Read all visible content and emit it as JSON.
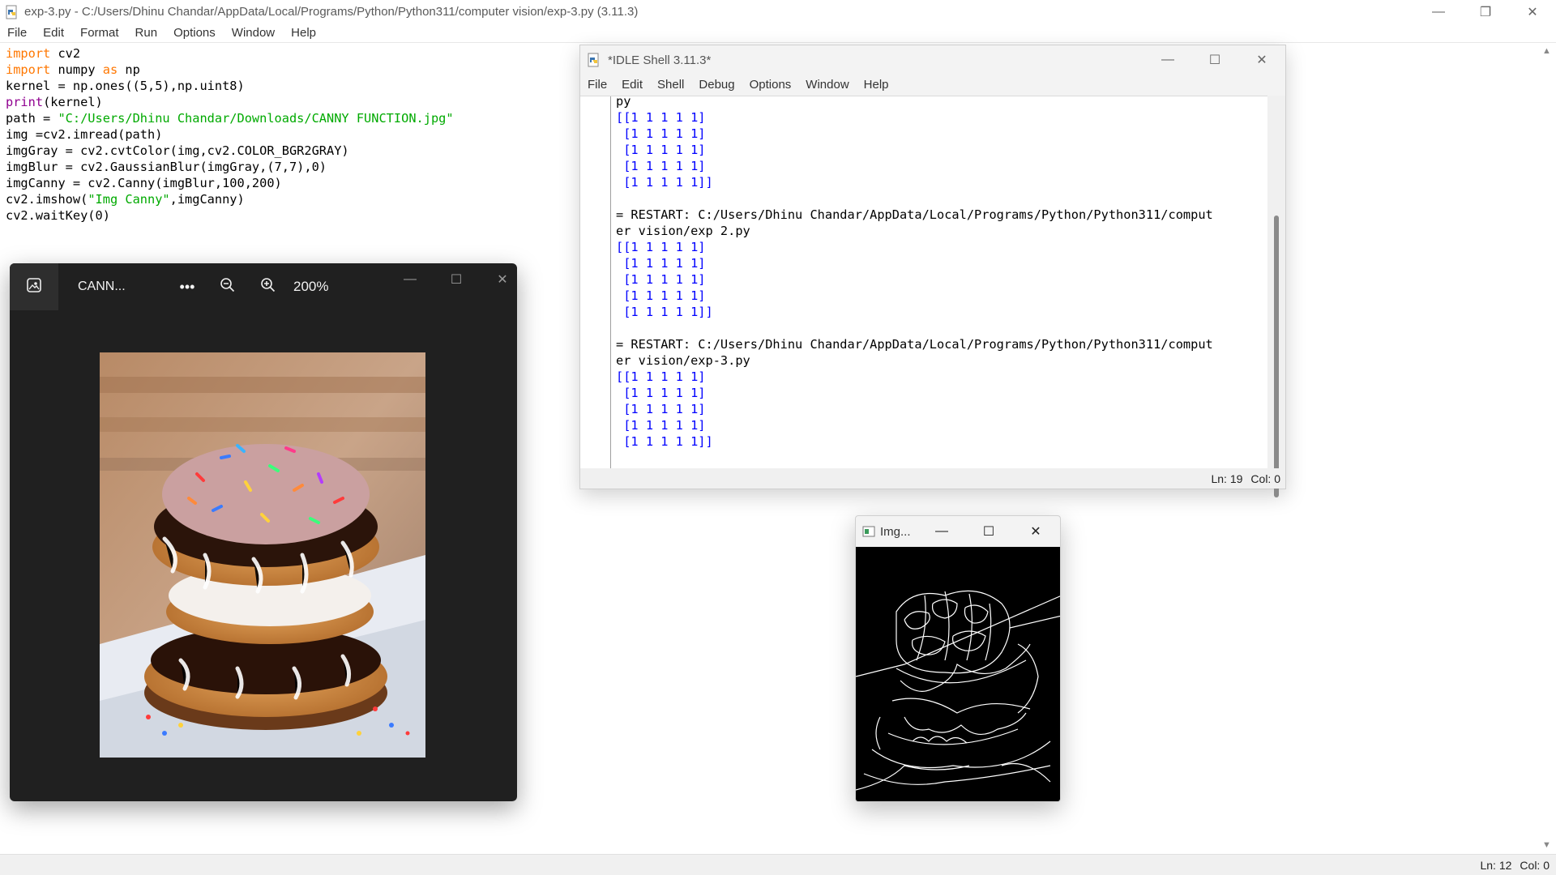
{
  "editor": {
    "title": "exp-3.py - C:/Users/Dhinu Chandar/AppData/Local/Programs/Python/Python311/computer vision/exp-3.py (3.11.3)",
    "menu": [
      "File",
      "Edit",
      "Format",
      "Run",
      "Options",
      "Window",
      "Help"
    ],
    "code": [
      {
        "kw": "import",
        "rest": " cv2"
      },
      {
        "kw": "import",
        "rest": " numpy ",
        "kw2": "as",
        "rest2": " np"
      },
      {
        "plain": "kernel = np.ones((5,5),np.uint8)"
      },
      {
        "bi": "print",
        "rest": "(kernel)"
      },
      {
        "plain": "path = ",
        "str": "\"C:/Users/Dhinu Chandar/Downloads/CANNY FUNCTION.jpg\""
      },
      {
        "plain": "img =cv2.imread(path)"
      },
      {
        "plain": "imgGray = cv2.cvtColor(img,cv2.COLOR_BGR2GRAY)"
      },
      {
        "plain": "imgBlur = cv2.GaussianBlur(imgGray,(7,7),0)"
      },
      {
        "plain": "imgCanny = cv2.Canny(imgBlur,100,200)"
      },
      {
        "plain": "cv2.imshow(",
        "str": "\"Img Canny\"",
        "after": ",imgCanny)"
      },
      {
        "plain": "cv2.waitKey(0)"
      }
    ],
    "status": {
      "ln": "Ln: 12",
      "col": "Col: 0"
    }
  },
  "shell": {
    "title": "*IDLE Shell 3.11.3*",
    "menu": [
      "File",
      "Edit",
      "Shell",
      "Debug",
      "Options",
      "Window",
      "Help"
    ],
    "lines": [
      {
        "t": "py",
        "out": false
      },
      {
        "t": "[[1 1 1 1 1]",
        "out": true
      },
      {
        "t": " [1 1 1 1 1]",
        "out": true
      },
      {
        "t": " [1 1 1 1 1]",
        "out": true
      },
      {
        "t": " [1 1 1 1 1]",
        "out": true
      },
      {
        "t": " [1 1 1 1 1]]",
        "out": true
      },
      {
        "t": "",
        "out": false
      },
      {
        "t": "= RESTART: C:/Users/Dhinu Chandar/AppData/Local/Programs/Python/Python311/comput",
        "out": false
      },
      {
        "t": "er vision/exp 2.py",
        "out": false
      },
      {
        "t": "[[1 1 1 1 1]",
        "out": true
      },
      {
        "t": " [1 1 1 1 1]",
        "out": true
      },
      {
        "t": " [1 1 1 1 1]",
        "out": true
      },
      {
        "t": " [1 1 1 1 1]",
        "out": true
      },
      {
        "t": " [1 1 1 1 1]]",
        "out": true
      },
      {
        "t": "",
        "out": false
      },
      {
        "t": "= RESTART: C:/Users/Dhinu Chandar/AppData/Local/Programs/Python/Python311/comput",
        "out": false
      },
      {
        "t": "er vision/exp-3.py",
        "out": false
      },
      {
        "t": "[[1 1 1 1 1]",
        "out": true
      },
      {
        "t": " [1 1 1 1 1]",
        "out": true
      },
      {
        "t": " [1 1 1 1 1]",
        "out": true
      },
      {
        "t": " [1 1 1 1 1]",
        "out": true
      },
      {
        "t": " [1 1 1 1 1]]",
        "out": true
      }
    ],
    "status": {
      "ln": "Ln: 19",
      "col": "Col: 0"
    }
  },
  "photos": {
    "filename": "CANN...",
    "zoom": "200%",
    "icons": [
      "gallery-icon",
      "more-icon",
      "zoom-out-icon",
      "zoom-in-icon",
      "minimize-icon",
      "maximize-icon",
      "close-icon"
    ]
  },
  "canny": {
    "title": "Img..."
  },
  "colors": {
    "keyword": "#ff7700",
    "builtin": "#900090",
    "string": "#00aa00",
    "shell_output": "#0000ff",
    "photos_bg": "#202020"
  }
}
